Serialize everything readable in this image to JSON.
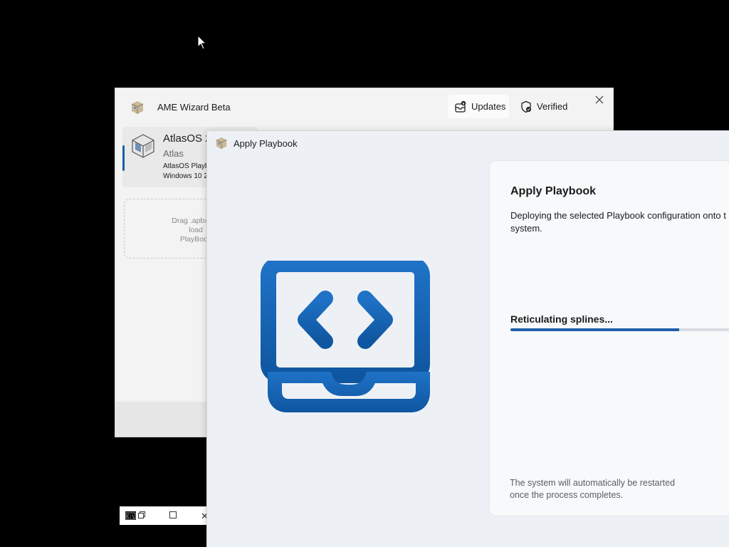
{
  "ame_window": {
    "title": "AME Wizard Beta",
    "updates_label": "Updates",
    "verified_label": "Verified",
    "playbook": {
      "name": "AtlasOS 2",
      "author": "Atlas",
      "description_line1": "AtlasOS Playbo",
      "description_line2": "Windows 10 2"
    },
    "drop_zone_text": "Drag .apbx file\nload\nPlayBook"
  },
  "apply_window": {
    "title": "Apply Playbook",
    "heading": "Apply Playbook",
    "description": "Deploying the selected Playbook configuration onto t system.",
    "progress_label": "Reticulating splines...",
    "progress_fraction": 0.74,
    "restart_note": "The system will automatically be restarted once the process completes."
  },
  "colors": {
    "accent": "#1f5fa9",
    "icon_blue": "#1a64b4"
  },
  "icons": [
    "updates-icon",
    "verified-shield-icon",
    "close-icon",
    "laptop-code-icon",
    "console-icon"
  ]
}
